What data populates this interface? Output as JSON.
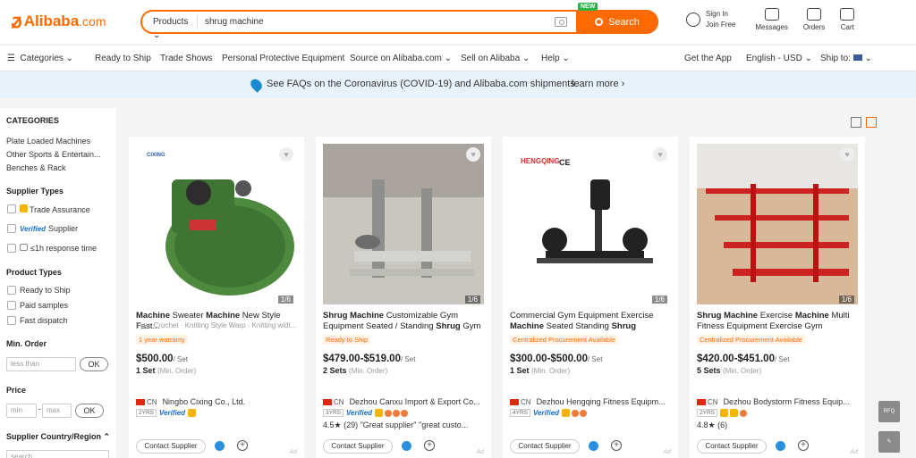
{
  "header": {
    "logo_text": "Alibaba",
    "logo_domain": ".com",
    "search_category": "Products",
    "search_value": "shrug machine",
    "new_badge": "NEW",
    "search_button": "Search",
    "sign_in": "Sign In",
    "join_free": "Join Free",
    "messages": "Messages",
    "orders": "Orders",
    "cart": "Cart"
  },
  "nav": {
    "categories": "Categories",
    "ready_to_ship": "Ready to Ship",
    "trade_shows": "Trade Shows",
    "ppe": "Personal Protective Equipment",
    "source": "Source on Alibaba.com",
    "sell": "Sell on Alibaba",
    "help": "Help",
    "get_app": "Get the App",
    "language": "English - USD",
    "ship_to": "Ship to:"
  },
  "banner": {
    "text": "See FAQs on the Coronavirus (COVID-19) and Alibaba.com shipments",
    "learn_more": "learn more"
  },
  "sidebar": {
    "categories_heading": "CATEGORIES",
    "categories": [
      "Plate Loaded Machines",
      "Other Sports & Entertain...",
      "Benches & Rack"
    ],
    "supplier_types_heading": "Supplier Types",
    "supplier_types": [
      "Trade Assurance",
      "Verified Supplier",
      "≤1h response time"
    ],
    "verified_prefix": "Verified",
    "verified_suffix": "Supplier",
    "product_types_heading": "Product Types",
    "product_types": [
      "Ready to Ship",
      "Paid samples",
      "Fast dispatch"
    ],
    "min_order_heading": "Min. Order",
    "min_order_placeholder": "less than",
    "ok": "OK",
    "price_heading": "Price",
    "price_min_placeholder": "min",
    "price_max_placeholder": "max",
    "supplier_country_heading": "Supplier Country/Region",
    "search_placeholder": "search"
  },
  "products": [
    {
      "title_parts": [
        "Machine",
        " Sweater ",
        "Machine",
        " New Style Fast..."
      ],
      "subtitle": "Type Crochet · Knitting Style Warp · Knitting widt...",
      "tag": "1 year warranty",
      "price": "$500.00",
      "unit": "/ Set",
      "moq": "1 Set",
      "moq_label": "(Min. Order)",
      "country": "CN",
      "supplier": "Ningbo Cixing Co., Ltd.",
      "years": "2YRS",
      "rating": "",
      "image_count": "1/6",
      "ad": "Ad"
    },
    {
      "title_parts": [
        "Shrug Machine",
        " Customizable Gym Equipment Seated / Standing ",
        "Shrug",
        " Gym"
      ],
      "subtitle": "",
      "tag": "Ready to Ship",
      "price": "$479.00-$519.00",
      "unit": "/ Set",
      "moq": "2 Sets",
      "moq_label": "(Min. Order)",
      "country": "CN",
      "supplier": "Dezhou Canxu Import & Export Co...",
      "years": "3YRS",
      "rating": "4.5★ (29) \"Great supplier\"  \"great custo...",
      "image_count": "1/6",
      "ad": "Ad"
    },
    {
      "title_parts": [
        "Commercial Gym Equipment Exercise ",
        "Machine",
        " Seated Standing ",
        "Shrug"
      ],
      "subtitle": "",
      "tag": "Centralized Procurement Available",
      "price": "$300.00-$500.00",
      "unit": "/ Set",
      "moq": "1 Set",
      "moq_label": "(Min. Order)",
      "country": "CN",
      "supplier": "Dezhou Hengqing Fitness Equipm...",
      "years": "4YRS",
      "rating": "",
      "image_count": "1/6",
      "ad": "Ad"
    },
    {
      "title_parts": [
        "Shrug Machine",
        " Exercise ",
        "Machine",
        " Multi Fitness Equipment Exercise Gym"
      ],
      "subtitle": "",
      "tag": "Centralized Procurement Available",
      "price": "$420.00-$451.00",
      "unit": "/ Set",
      "moq": "5 Sets",
      "moq_label": "(Min. Order)",
      "country": "CN",
      "supplier": "Dezhou Bodystorm Fitness Equip...",
      "years": "2YRS",
      "rating": "4.8★ (6)",
      "image_count": "1/6",
      "ad": "Ad"
    }
  ],
  "contact_label": "Contact Supplier",
  "colors": {
    "brand": "#ff6a00",
    "banner_bg": "#e8f2fb",
    "verified": "#1b6fc9"
  }
}
